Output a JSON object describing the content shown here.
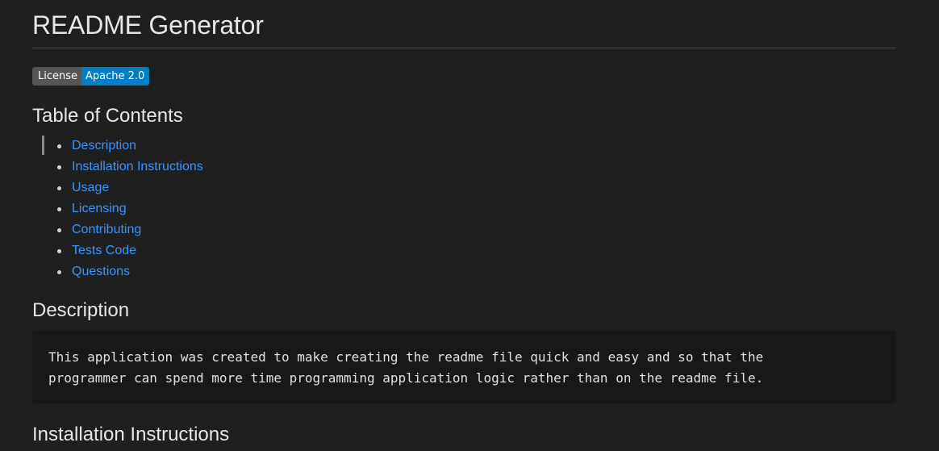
{
  "document": {
    "title": "README Generator",
    "badge": {
      "label": "License",
      "value": "Apache 2.0",
      "colors": {
        "label_bg": "#555555",
        "value_bg": "#007ec6"
      }
    },
    "toc": {
      "heading": "Table of Contents",
      "items": [
        "Description",
        "Installation Instructions",
        "Usage",
        "Licensing",
        "Contributing",
        "Tests Code",
        "Questions"
      ]
    },
    "description": {
      "heading": "Description",
      "code_lines": [
        "This application was created to make creating the readme file quick and easy and so that the",
        "programmer can spend more time programming application logic rather than on the readme file."
      ]
    },
    "installation": {
      "heading": "Installation Instructions"
    }
  },
  "colors": {
    "background": "#1f1f1f",
    "link": "#3794ff",
    "code_bg": "#181818"
  }
}
